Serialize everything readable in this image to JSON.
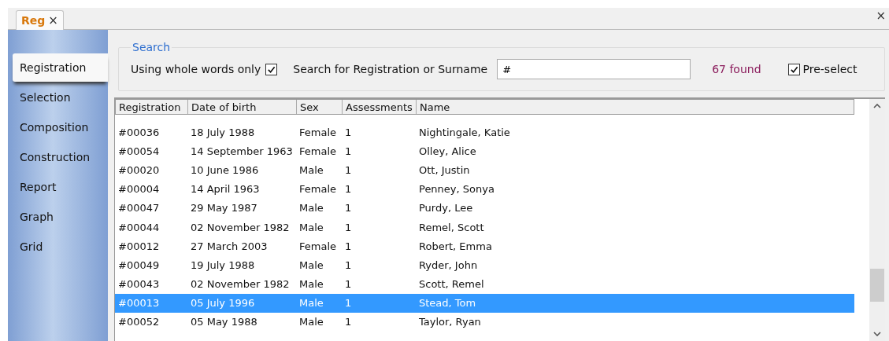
{
  "document_tabs": [
    {
      "label": "Reg",
      "selected": true,
      "close": "×"
    }
  ],
  "window_close": "×",
  "sidebar": {
    "items": [
      {
        "label": "Registration",
        "selected": true
      },
      {
        "label": "Selection",
        "selected": false
      },
      {
        "label": "Composition",
        "selected": false
      },
      {
        "label": "Construction",
        "selected": false
      },
      {
        "label": "Report",
        "selected": false
      },
      {
        "label": "Graph",
        "selected": false
      },
      {
        "label": "Grid",
        "selected": false
      }
    ]
  },
  "search": {
    "title": "Search",
    "whole_words_label": "Using whole words only",
    "whole_words_checked": true,
    "search_label": "Search for Registration or Surname",
    "value": "#",
    "found": "67 found",
    "preselect_label": "Pre-select",
    "preselect_checked": true
  },
  "table": {
    "columns": [
      "Registration",
      "Date of birth",
      "Sex",
      "Assessments",
      "Name"
    ],
    "rows": [
      {
        "cells": [
          "#00036",
          "18 July 1988",
          "Female",
          "1",
          "Nightingale, Katie"
        ],
        "selected": false
      },
      {
        "cells": [
          "#00054",
          "14 September 1963",
          "Female",
          "1",
          "Olley, Alice"
        ],
        "selected": false
      },
      {
        "cells": [
          "#00020",
          "10 June 1986",
          "Male",
          "1",
          "Ott, Justin"
        ],
        "selected": false
      },
      {
        "cells": [
          "#00004",
          "14 April 1963",
          "Female",
          "1",
          "Penney, Sonya"
        ],
        "selected": false
      },
      {
        "cells": [
          "#00047",
          "29 May 1987",
          "Male",
          "1",
          "Purdy, Lee"
        ],
        "selected": false
      },
      {
        "cells": [
          "#00044",
          "02 November 1982",
          "Male",
          "1",
          "Remel, Scott"
        ],
        "selected": false
      },
      {
        "cells": [
          "#00012",
          "27 March 2003",
          "Female",
          "1",
          "Robert, Emma"
        ],
        "selected": false
      },
      {
        "cells": [
          "#00049",
          "19 July 1988",
          "Male",
          "1",
          "Ryder, John"
        ],
        "selected": false
      },
      {
        "cells": [
          "#00043",
          "02 November 1982",
          "Male",
          "1",
          "Scott, Remel"
        ],
        "selected": false
      },
      {
        "cells": [
          "#00013",
          "05 July 1996",
          "Male",
          "1",
          "Stead, Tom"
        ],
        "selected": true
      },
      {
        "cells": [
          "#00052",
          "05 May 1988",
          "Male",
          "1",
          "Taylor, Ryan"
        ],
        "selected": false
      }
    ]
  }
}
